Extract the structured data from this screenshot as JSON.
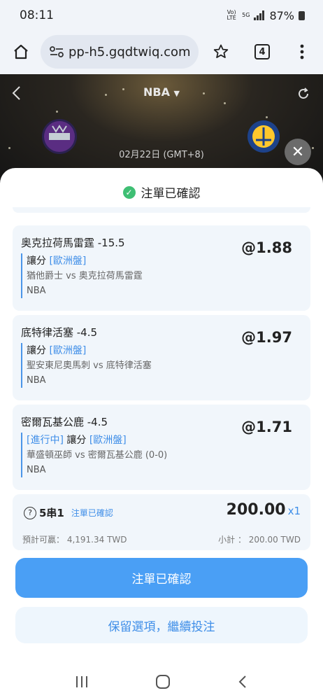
{
  "status_bar": {
    "time": "08:11",
    "network": "Vo) LTE",
    "network2": "5G",
    "battery": "87%"
  },
  "browser": {
    "url": "pp-h5.gqdtwiq.com",
    "tab_count": "4"
  },
  "game": {
    "league": "NBA",
    "date": "02月22日 (GMT+8)"
  },
  "sheet": {
    "title": "注單已確認",
    "bets": [
      {
        "market": "奥克拉荷馬雷霆 -15.5",
        "bet_prefix": "",
        "bet_type": "讓分",
        "odds_type": "[歐洲盤]",
        "matchup": "猶他爵士 vs 奥克拉荷馬雷霆",
        "league": "NBA",
        "odds": "@1.88"
      },
      {
        "market": "底特律活塞 -4.5",
        "bet_prefix": "",
        "bet_type": "讓分",
        "odds_type": "[歐洲盤]",
        "matchup": "聖安東尼奧馬刺 vs 底特律活塞",
        "league": "NBA",
        "odds": "@1.97"
      },
      {
        "market": "密爾瓦基公鹿 -4.5",
        "bet_prefix": "[進行中]",
        "bet_type": "讓分",
        "odds_type": "[歐洲盤]",
        "matchup": "華盛頓巫師 vs 密爾瓦基公鹿 (0-0)",
        "league": "NBA",
        "odds": "@1.71"
      }
    ],
    "summary": {
      "parlay": "5串1",
      "status": "注單已確認",
      "stake": "200.00",
      "multiplier": "x1",
      "potential_win": "預計可贏： 4,191.34 TWD",
      "subtotal": "小計 ： 200.00 TWD"
    },
    "confirm_button": "注單已確認",
    "keep_button": "保留選項，繼續投注"
  },
  "colors": {
    "accent": "#4a9ff5",
    "card_bg": "#f1f6fb",
    "success": "#3fbf74"
  }
}
